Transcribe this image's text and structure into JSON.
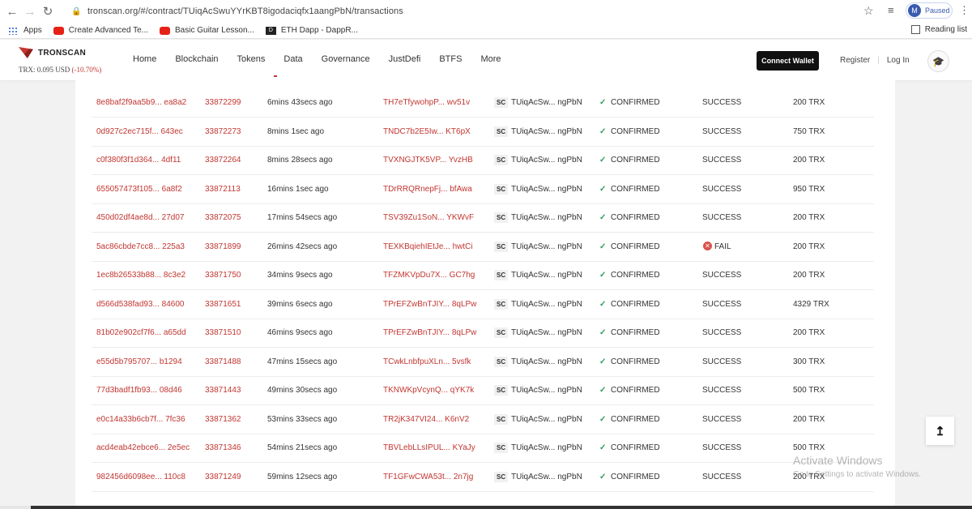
{
  "browser": {
    "back_icon": "arrow-left-icon",
    "forward_icon": "arrow-right-icon",
    "reload_icon": "reload-icon",
    "url": "tronscan.org/#/contract/TUiqAcSwuYYrKBT8igodaciqfx1aangPbN/transactions",
    "profile_initial": "M",
    "profile_status": "Paused"
  },
  "bookmarks": {
    "items": [
      {
        "label": "Apps",
        "icon": "apps-grid-icon"
      },
      {
        "label": "Create Advanced Te...",
        "icon": "youtube-icon"
      },
      {
        "label": "Basic Guitar Lesson...",
        "icon": "youtube-icon"
      },
      {
        "label": "ETH Dapp - DappR...",
        "icon": "dappradar-icon"
      }
    ],
    "reading_list": "Reading list"
  },
  "site": {
    "logo_text": "TRONSCAN",
    "price_label": "TRX: 0.095 USD",
    "price_change": "(-10.70%)",
    "nav": [
      "Home",
      "Blockchain",
      "Tokens",
      "Data",
      "Governance",
      "JustDefi",
      "BTFS",
      "More"
    ],
    "connect_wallet": "Connect Wallet",
    "register": "Register",
    "login": "Log In"
  },
  "transactions": [
    {
      "hash": "8e8baf2f9aa5b9... ea8a2",
      "block": "33872299",
      "age": "6mins 43secs ago",
      "from": "TH7eTfywohpP... wv51v",
      "to": "TUiqAcSw... ngPbN",
      "status": "CONFIRMED",
      "result": "SUCCESS",
      "amount": "200 TRX"
    },
    {
      "hash": "0d927c2ec715f... 643ec",
      "block": "33872273",
      "age": "8mins 1sec ago",
      "from": "TNDC7b2E5Iw... KT6pX",
      "to": "TUiqAcSw... ngPbN",
      "status": "CONFIRMED",
      "result": "SUCCESS",
      "amount": "750 TRX"
    },
    {
      "hash": "c0f380f3f1d364... 4df11",
      "block": "33872264",
      "age": "8mins 28secs ago",
      "from": "TVXNGJTK5VP... YvzHB",
      "to": "TUiqAcSw... ngPbN",
      "status": "CONFIRMED",
      "result": "SUCCESS",
      "amount": "200 TRX"
    },
    {
      "hash": "655057473f105... 6a8f2",
      "block": "33872113",
      "age": "16mins 1sec ago",
      "from": "TDrRRQRnepFj... bfAwa",
      "to": "TUiqAcSw... ngPbN",
      "status": "CONFIRMED",
      "result": "SUCCESS",
      "amount": "950 TRX"
    },
    {
      "hash": "450d02df4ae8d... 27d07",
      "block": "33872075",
      "age": "17mins 54secs ago",
      "from": "TSV39Zu1SoN... YKWvF",
      "to": "TUiqAcSw... ngPbN",
      "status": "CONFIRMED",
      "result": "SUCCESS",
      "amount": "200 TRX"
    },
    {
      "hash": "5ac86cbde7cc8... 225a3",
      "block": "33871899",
      "age": "26mins 42secs ago",
      "from": "TEXKBqiehIEtJe... hwtCi",
      "to": "TUiqAcSw... ngPbN",
      "status": "CONFIRMED",
      "result": "FAIL",
      "amount": "200 TRX"
    },
    {
      "hash": "1ec8b26533b88... 8c3e2",
      "block": "33871750",
      "age": "34mins 9secs ago",
      "from": "TFZMKVpDu7X... GC7hg",
      "to": "TUiqAcSw... ngPbN",
      "status": "CONFIRMED",
      "result": "SUCCESS",
      "amount": "200 TRX"
    },
    {
      "hash": "d566d538fad93... 84600",
      "block": "33871651",
      "age": "39mins 6secs ago",
      "from": "TPrEFZwBnTJIY... 8qLPw",
      "to": "TUiqAcSw... ngPbN",
      "status": "CONFIRMED",
      "result": "SUCCESS",
      "amount": "4329 TRX"
    },
    {
      "hash": "81b02e902cf7f6... a65dd",
      "block": "33871510",
      "age": "46mins 9secs ago",
      "from": "TPrEFZwBnTJIY... 8qLPw",
      "to": "TUiqAcSw... ngPbN",
      "status": "CONFIRMED",
      "result": "SUCCESS",
      "amount": "200 TRX"
    },
    {
      "hash": "e55d5b795707... b1294",
      "block": "33871488",
      "age": "47mins 15secs ago",
      "from": "TCwkLnbfpuXLn... 5vsfk",
      "to": "TUiqAcSw... ngPbN",
      "status": "CONFIRMED",
      "result": "SUCCESS",
      "amount": "300 TRX"
    },
    {
      "hash": "77d3badf1fb93... 08d46",
      "block": "33871443",
      "age": "49mins 30secs ago",
      "from": "TKNWKpVcynQ... qYK7k",
      "to": "TUiqAcSw... ngPbN",
      "status": "CONFIRMED",
      "result": "SUCCESS",
      "amount": "500 TRX"
    },
    {
      "hash": "e0c14a33b6cb7f... 7fc36",
      "block": "33871362",
      "age": "53mins 33secs ago",
      "from": "TR2jK347VI24... K6nV2",
      "to": "TUiqAcSw... ngPbN",
      "status": "CONFIRMED",
      "result": "SUCCESS",
      "amount": "200 TRX"
    },
    {
      "hash": "acd4eab42ebce6... 2e5ec",
      "block": "33871346",
      "age": "54mins 21secs ago",
      "from": "TBVLebLLsIPUL... KYaJy",
      "to": "TUiqAcSw... ngPbN",
      "status": "CONFIRMED",
      "result": "SUCCESS",
      "amount": "500 TRX"
    },
    {
      "hash": "982456d6098ee... 110c8",
      "block": "33871249",
      "age": "59mins 12secs ago",
      "from": "TF1GFwCWA53t... 2n7jg",
      "to": "TUiqAcSw... ngPbN",
      "status": "CONFIRMED",
      "result": "SUCCESS",
      "amount": "200 TRX"
    }
  ],
  "type_badge": "SC",
  "windows": {
    "activate_title": "Activate Windows",
    "activate_sub": "Go to Settings to activate Windows."
  }
}
